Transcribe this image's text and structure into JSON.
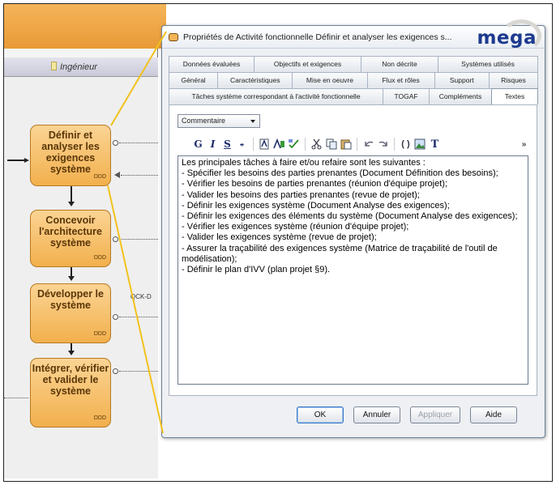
{
  "diagram": {
    "lane_label": "Ingénieur",
    "activities": [
      {
        "label": "Définir et analyser les exigences système",
        "code": "DDD"
      },
      {
        "label": "Concevoir l'architecture système",
        "code": "DDD"
      },
      {
        "label": "Développer le système",
        "code": "DDD"
      },
      {
        "label": "Intégrer, vérifier et valider le système",
        "code": "DDD"
      }
    ],
    "side_label": "QCK-D"
  },
  "dialog": {
    "title": "Propriétés de Activité fonctionnelle Définir et analyser les exigences s...",
    "logo": "mega",
    "tab_rows": [
      [
        "Données évaluées",
        "Objectifs et exigences",
        "Non décrite",
        "Systèmes utilisés"
      ],
      [
        "Général",
        "Caractéristiques",
        "Mise en oeuvre",
        "Flux et rôles",
        "Support",
        "Risques"
      ],
      [
        "Tâches système correspondant à l'activité fonctionnelle",
        "TOGAF",
        "Compléments",
        "Textes"
      ]
    ],
    "active_tab": "Textes",
    "text_type_select": "Commentaire",
    "toolbar": [
      "G",
      "I",
      "S",
      "ABC",
      "font",
      "style",
      "spell",
      "cut",
      "copy",
      "paste",
      "undo",
      "redo",
      "braces",
      "image",
      "T"
    ],
    "text_lines": [
      "Les principales tâches à faire et/ou refaire sont les suivantes :",
      "- Spécifier les besoins des parties prenantes (Document Définition des besoins);",
      "- Vérifier les besoins de parties prenantes (réunion d'équipe projet);",
      "- Valider les besoins des parties prenantes (revue de projet);",
      "- Définir les exigences système (Document Analyse des exigences);",
      "- Définir les exigences des éléments du système (Document Analyse des exigences);",
      "- Vérifier les exigences système (réunion d'équipe projet);",
      "- Valider les exigences système (revue de projet);",
      "- Assurer la traçabilité des exigences système (Matrice de traçabilité de l'outil de modélisation);",
      "- Définir le plan d'IVV (plan projet §9)."
    ],
    "buttons": {
      "ok": "OK",
      "cancel": "Annuler",
      "apply": "Appliquer",
      "help": "Aide"
    }
  }
}
